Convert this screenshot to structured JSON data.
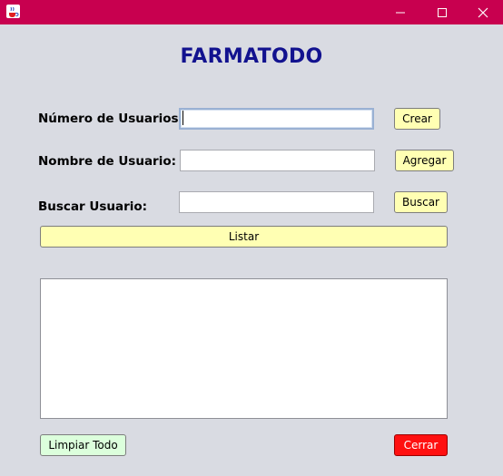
{
  "window": {
    "title": "",
    "icon": "java-cup-icon",
    "titlebar_color": "#c8004f",
    "controls": [
      "minimize-icon",
      "maximize-icon",
      "close-icon"
    ]
  },
  "header": {
    "title": "FARMATODO"
  },
  "form": {
    "numero_label": "Número de Usuarios:",
    "numero_value": "",
    "nombre_label": "Nombre de Usuario:",
    "nombre_value": "",
    "buscar_label": "Buscar Usuario:",
    "buscar_value": ""
  },
  "buttons": {
    "crear": "Crear",
    "agregar": "Agregar",
    "buscar": "Buscar",
    "listar": "Listar",
    "limpiar": "Limpiar Todo",
    "cerrar": "Cerrar"
  },
  "output": {
    "text": ""
  },
  "colors": {
    "background": "#d9dbe2",
    "title_text": "#12128f",
    "button_yellow": "#ffffb3",
    "button_green": "#dcffdc",
    "button_red": "#ff1010"
  }
}
